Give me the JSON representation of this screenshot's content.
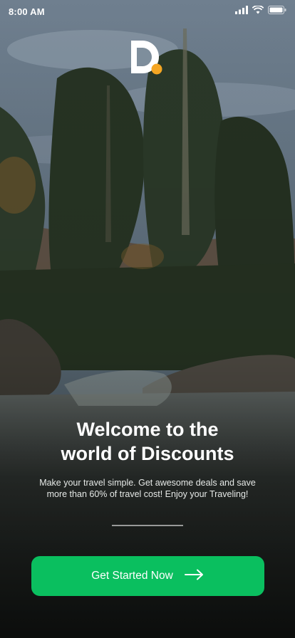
{
  "status_bar": {
    "time": "8:00 AM"
  },
  "welcome": {
    "title_line1": "Welcome to the",
    "title_line2": "world of Discounts"
  },
  "subtitle": {
    "line1": "Make your travel simple. Get awesome deals and save",
    "line2": "more than 60% of travel cost! Enjoy your Traveling!"
  },
  "cta": {
    "label": "Get Started Now",
    "icon": "arrow-right-icon"
  },
  "colors": {
    "accent": "#0abf5f",
    "logo_dot": "#f5a623",
    "text": "#ffffff"
  },
  "icons": [
    "signal-icon",
    "wifi-icon",
    "battery-icon",
    "app-logo",
    "arrow-right-icon"
  ]
}
